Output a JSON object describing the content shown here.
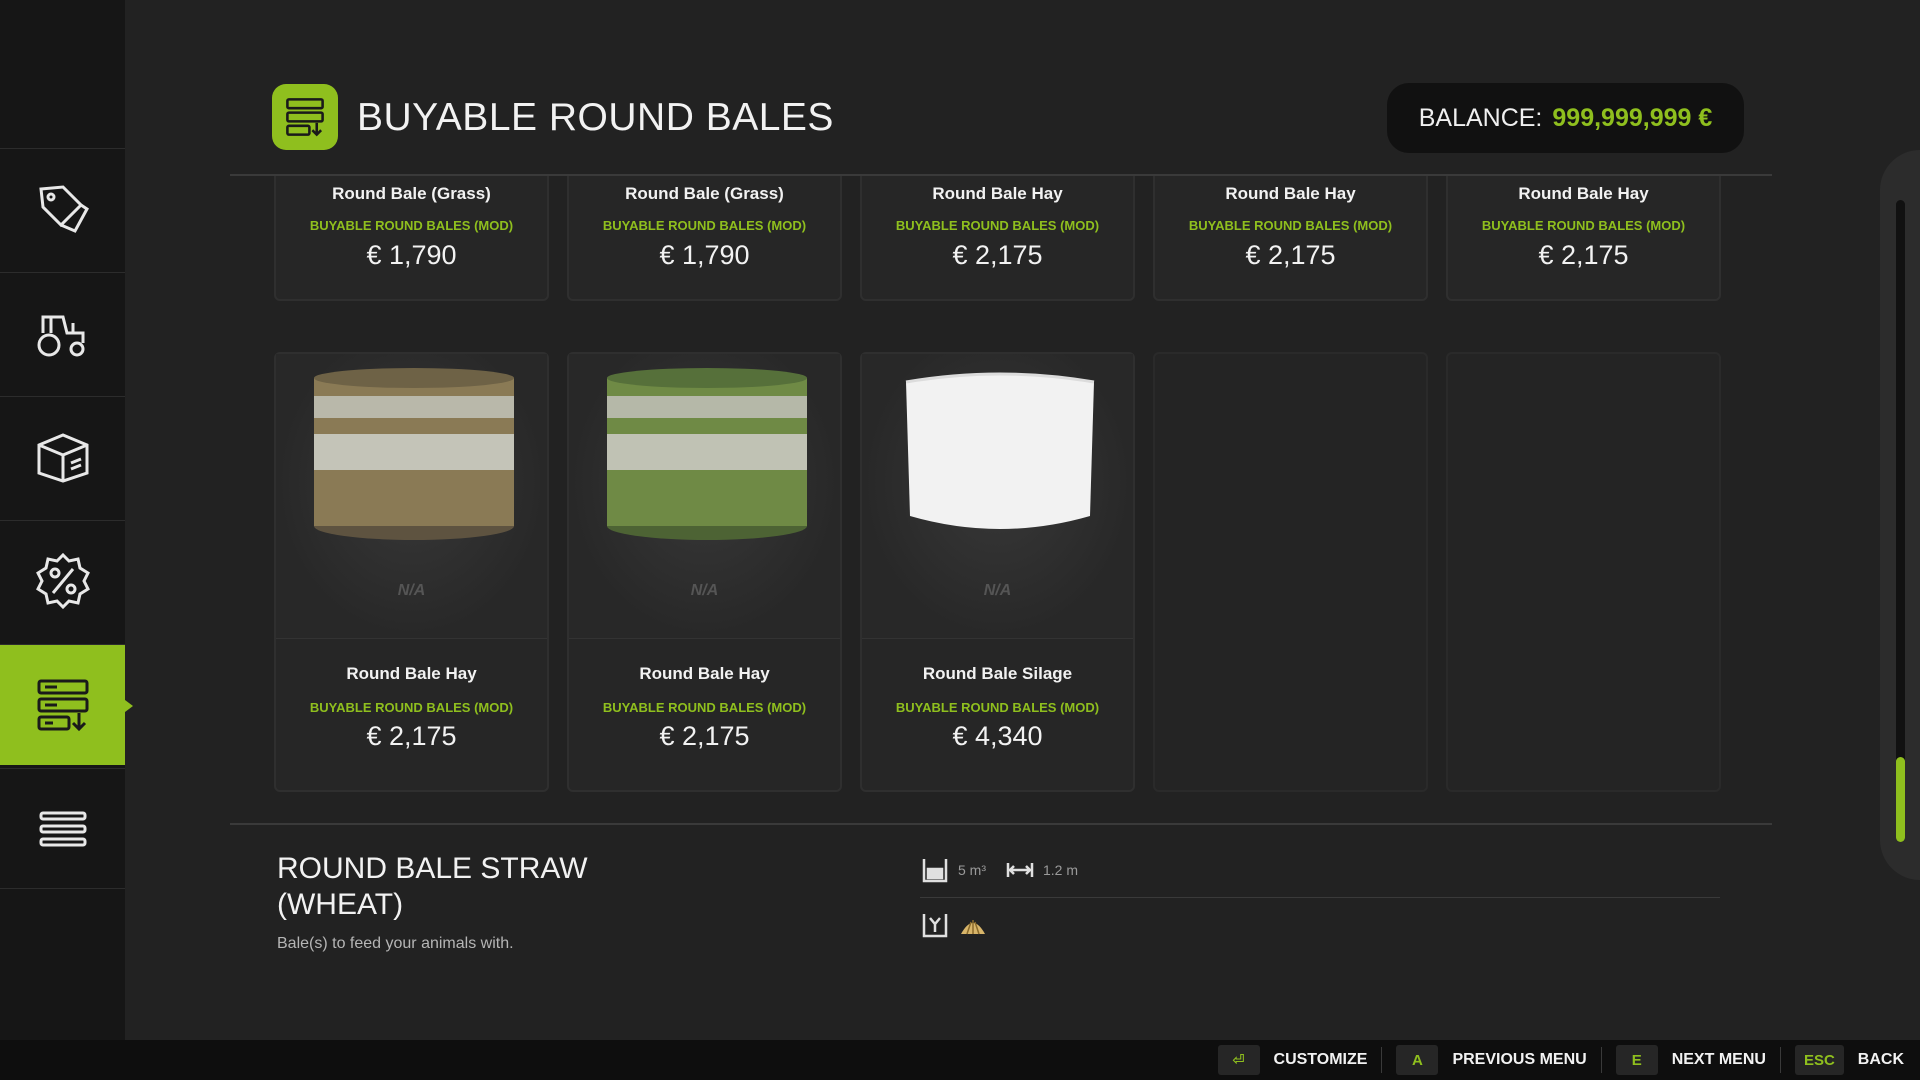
{
  "header": {
    "title": "BUYABLE ROUND BALES",
    "balance_label": "BALANCE:",
    "balance_value": "999,999,999 €"
  },
  "sidebar": {
    "items": [
      {
        "icon": "price-tag-icon"
      },
      {
        "icon": "tractor-icon"
      },
      {
        "icon": "box-icon"
      },
      {
        "icon": "percent-badge-icon"
      },
      {
        "icon": "bale-shop-icon",
        "active": true
      },
      {
        "icon": "list-menu-icon"
      }
    ]
  },
  "products_row1": [
    {
      "name": "Round Bale (Grass)",
      "source": "BUYABLE ROUND BALES (MOD)",
      "price": "€ 1,790"
    },
    {
      "name": "Round Bale (Grass)",
      "source": "BUYABLE ROUND BALES (MOD)",
      "price": "€ 1,790"
    },
    {
      "name": "Round Bale Hay",
      "source": "BUYABLE ROUND BALES (MOD)",
      "price": "€ 2,175"
    },
    {
      "name": "Round Bale Hay",
      "source": "BUYABLE ROUND BALES (MOD)",
      "price": "€ 2,175"
    },
    {
      "name": "Round Bale Hay",
      "source": "BUYABLE ROUND BALES (MOD)",
      "price": "€ 2,175"
    }
  ],
  "products_row2": [
    {
      "name": "Round Bale Hay",
      "source": "BUYABLE ROUND BALES (MOD)",
      "price": "€ 2,175",
      "availability": "N/A",
      "bale_color": "#8a7a55"
    },
    {
      "name": "Round Bale Hay",
      "source": "BUYABLE ROUND BALES (MOD)",
      "price": "€ 2,175",
      "availability": "N/A",
      "bale_color": "#6f8a45"
    },
    {
      "name": "Round Bale Silage",
      "source": "BUYABLE ROUND BALES (MOD)",
      "price": "€ 4,340",
      "availability": "N/A",
      "bale_color": "#f2f2f2"
    }
  ],
  "detail": {
    "title": "ROUND BALE STRAW (WHEAT)",
    "description": "Bale(s) to feed your animals with.",
    "volume": "5 m³",
    "width": "1.2 m"
  },
  "footer": {
    "customize_key": "⏎",
    "customize_label": "CUSTOMIZE",
    "prev_key": "A",
    "prev_label": "PREVIOUS MENU",
    "next_key": "E",
    "next_label": "NEXT MENU",
    "back_key": "ESC",
    "back_label": "BACK"
  },
  "colors": {
    "accent": "#8fbf1e",
    "background": "#222222",
    "sidebar": "#161616"
  }
}
